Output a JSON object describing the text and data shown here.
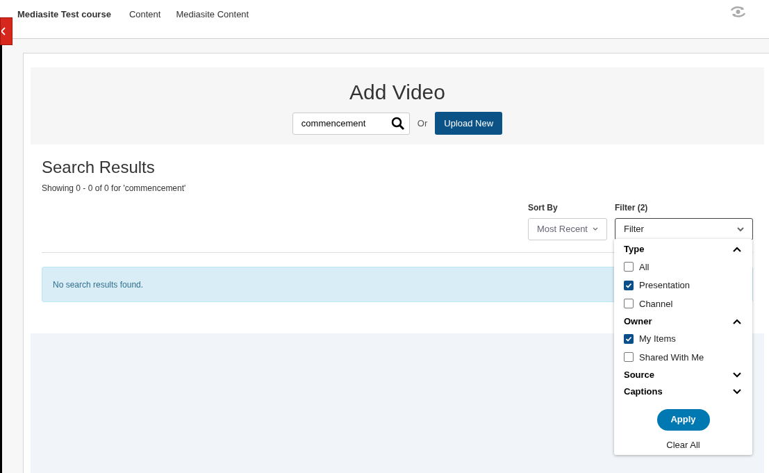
{
  "top_bar": {
    "course_title": "Mediasite Test course",
    "nav_links": [
      "Content",
      "Mediasite Content"
    ]
  },
  "add_video": {
    "title": "Add Video",
    "search": {
      "value": "commencement"
    },
    "or_label": "Or",
    "upload_button": "Upload New"
  },
  "search_results": {
    "title": "Search Results",
    "summary": "Showing 0 - 0 of 0 for 'commencement'",
    "sort": {
      "label": "Sort By",
      "value": "Most Recent"
    },
    "filter": {
      "label": "Filter (2)",
      "value": "Filter",
      "expanded": true
    },
    "message": "No search results found."
  },
  "filter_menu": {
    "groups": [
      {
        "title": "Type",
        "expanded": true,
        "options": [
          {
            "label": "All",
            "checked": false
          },
          {
            "label": "Presentation",
            "checked": true
          },
          {
            "label": "Channel",
            "checked": false
          }
        ]
      },
      {
        "title": "Owner",
        "expanded": true,
        "options": [
          {
            "label": "My Items",
            "checked": true
          },
          {
            "label": "Shared With Me",
            "checked": false
          }
        ]
      },
      {
        "title": "Source",
        "expanded": false
      },
      {
        "title": "Captions",
        "expanded": false
      }
    ],
    "apply_button": "Apply",
    "clear_link": "Clear All"
  }
}
